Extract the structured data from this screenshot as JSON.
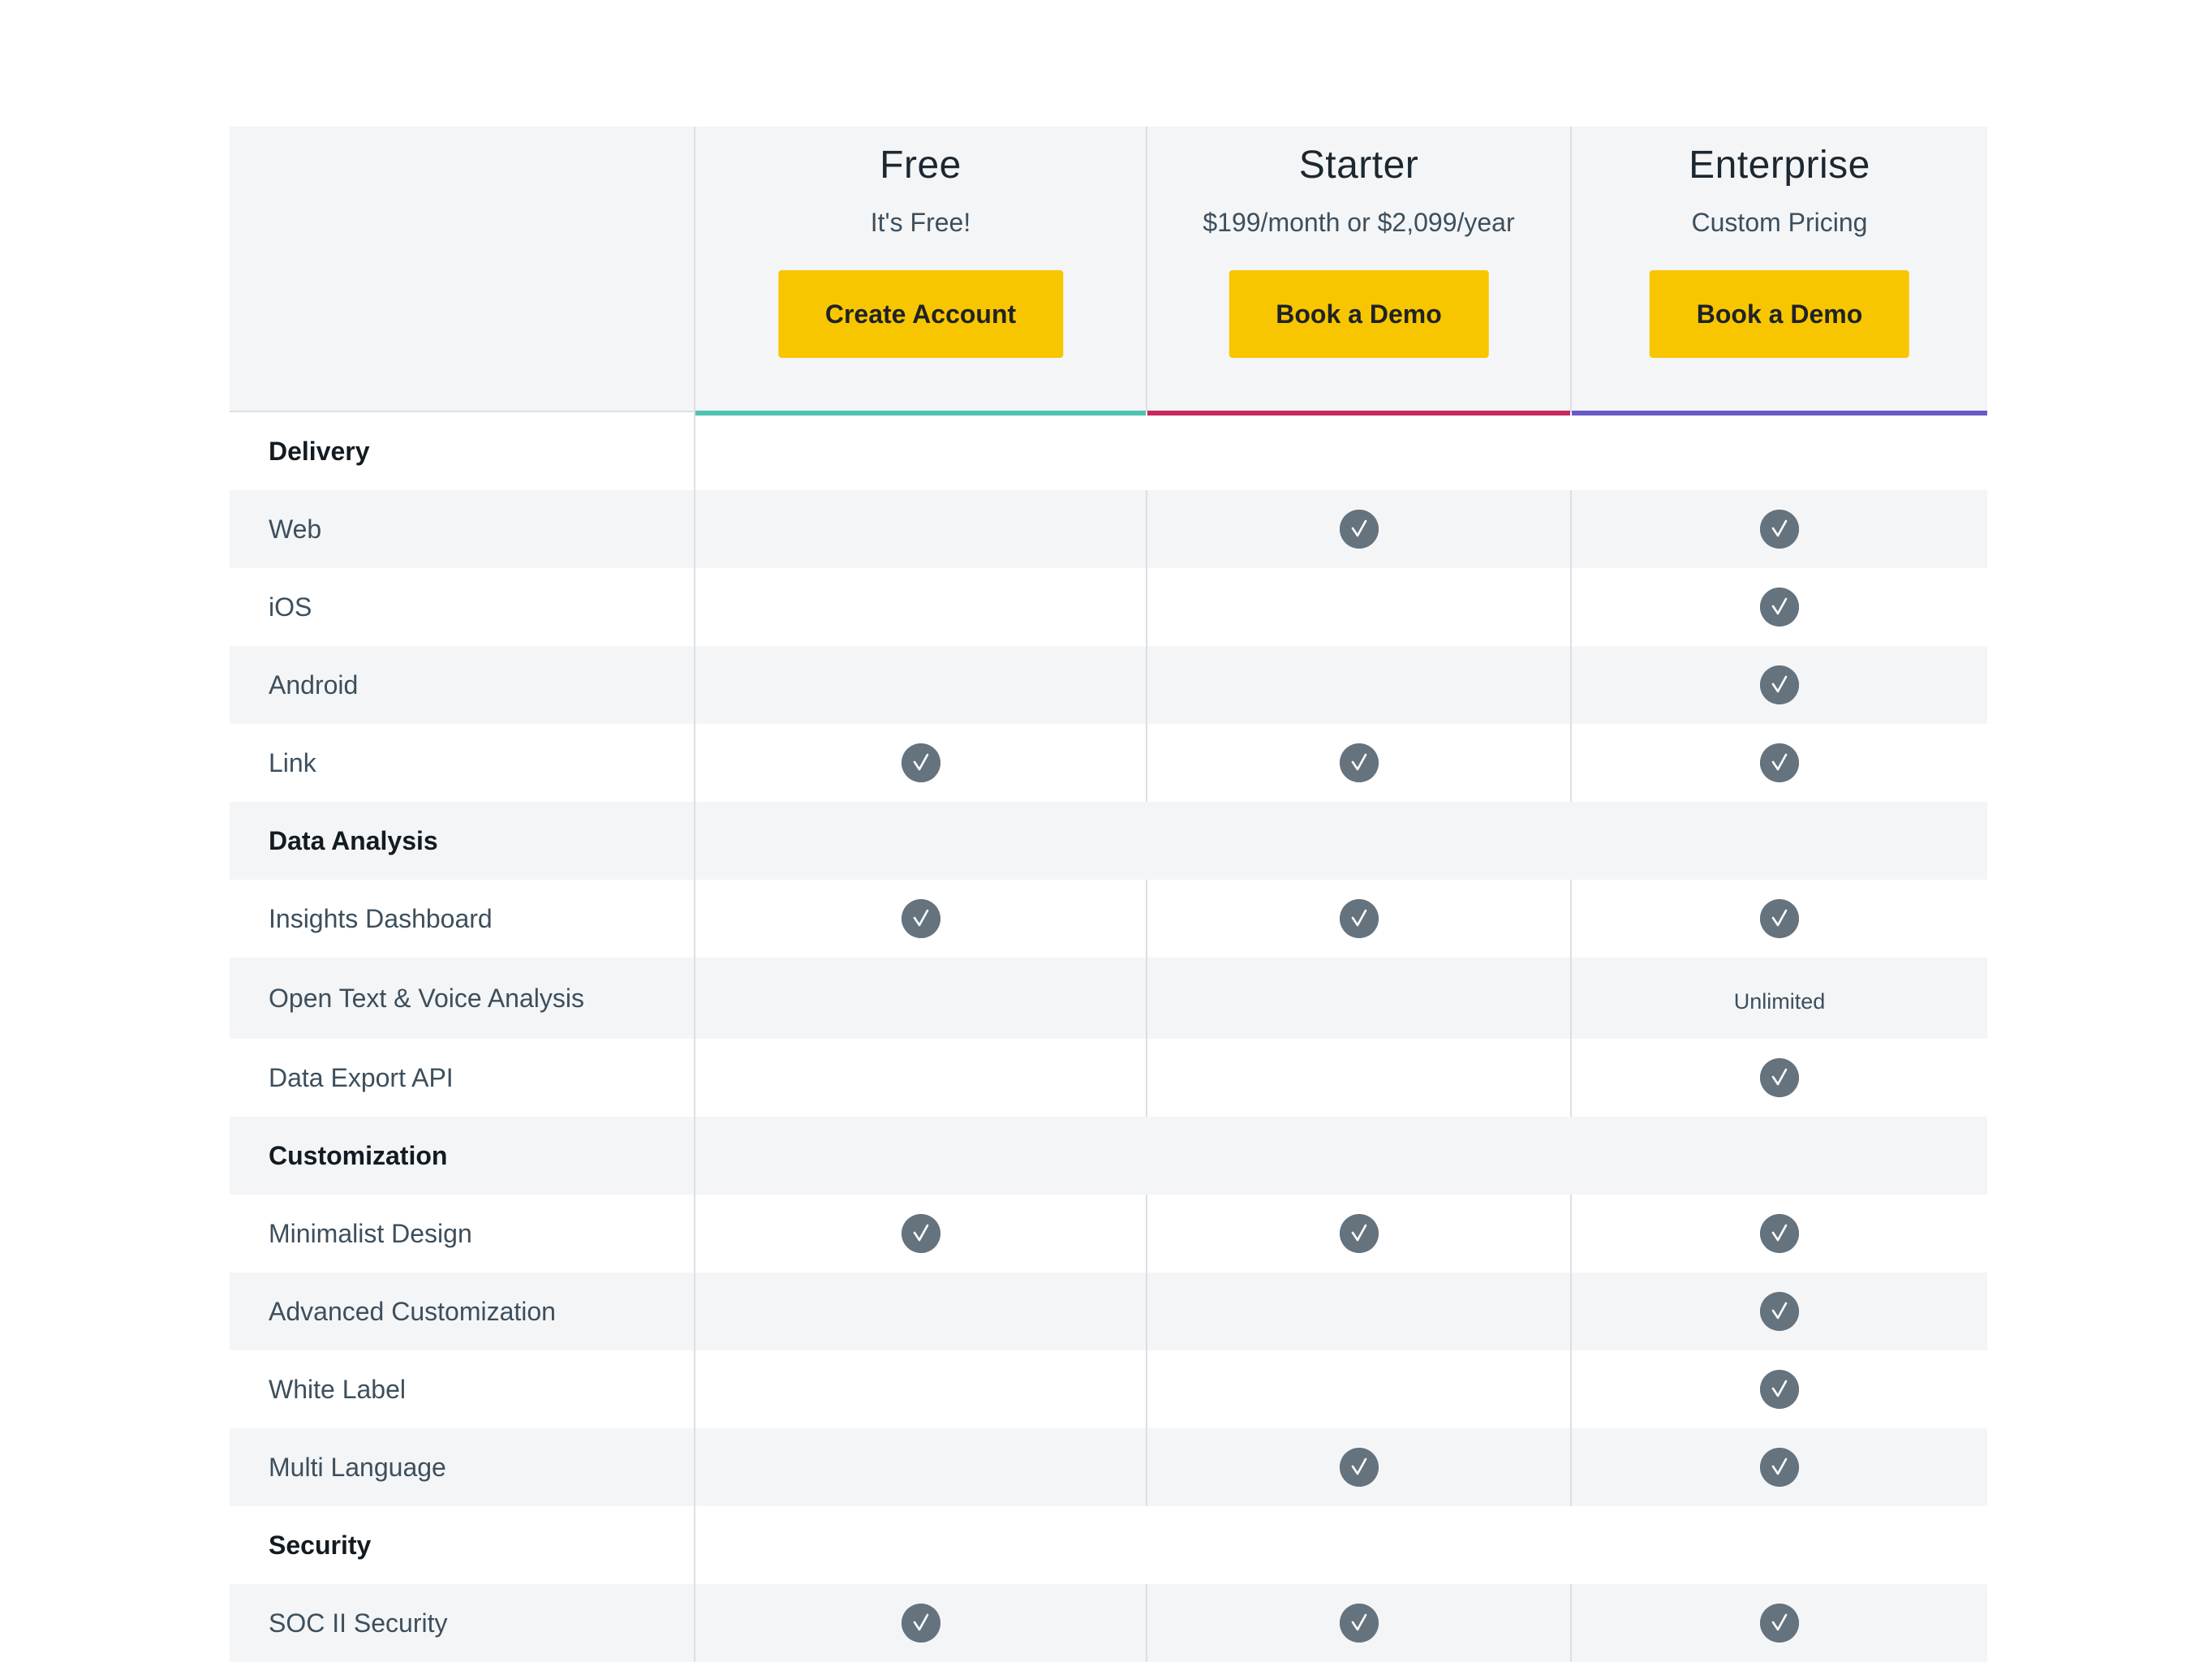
{
  "plans": [
    {
      "name": "Free",
      "price": "It's Free!",
      "button": "Create Account",
      "accent": "#4fc3b0"
    },
    {
      "name": "Starter",
      "price": "$199/month or $2,099/year",
      "button": "Book a Demo",
      "accent": "#c8285d"
    },
    {
      "name": "Enterprise",
      "price": "Custom Pricing",
      "button": "Book a Demo",
      "accent": "#6a5ac8"
    }
  ],
  "sections": [
    {
      "title": "Delivery",
      "rows": [
        {
          "label": "Web",
          "values": [
            "",
            "check",
            "check"
          ]
        },
        {
          "label": "iOS",
          "values": [
            "",
            "",
            "check"
          ]
        },
        {
          "label": "Android",
          "values": [
            "",
            "",
            "check"
          ]
        },
        {
          "label": "Link",
          "values": [
            "check",
            "check",
            "check"
          ]
        }
      ]
    },
    {
      "title": "Data Analysis",
      "rows": [
        {
          "label": "Insights Dashboard",
          "values": [
            "check",
            "check",
            "check"
          ]
        },
        {
          "label": "Open Text & Voice Analysis",
          "values": [
            "",
            "",
            "Unlimited"
          ]
        },
        {
          "label": "Data Export API",
          "values": [
            "",
            "",
            "check"
          ]
        }
      ]
    },
    {
      "title": "Customization",
      "rows": [
        {
          "label": "Minimalist Design",
          "values": [
            "check",
            "check",
            "check"
          ]
        },
        {
          "label": "Advanced Customization",
          "values": [
            "",
            "",
            "check"
          ]
        },
        {
          "label": "White Label",
          "values": [
            "",
            "",
            "check"
          ]
        },
        {
          "label": "Multi Language",
          "values": [
            "",
            "check",
            "check"
          ]
        }
      ]
    },
    {
      "title": "Security",
      "rows": [
        {
          "label": "SOC II Security",
          "values": [
            "check",
            "check",
            "check"
          ]
        }
      ]
    }
  ],
  "icons": {
    "check": "checkmark-circle-icon"
  },
  "colors": {
    "button": "#f8c600",
    "check": "#65737e",
    "shade": "#f4f5f7"
  }
}
